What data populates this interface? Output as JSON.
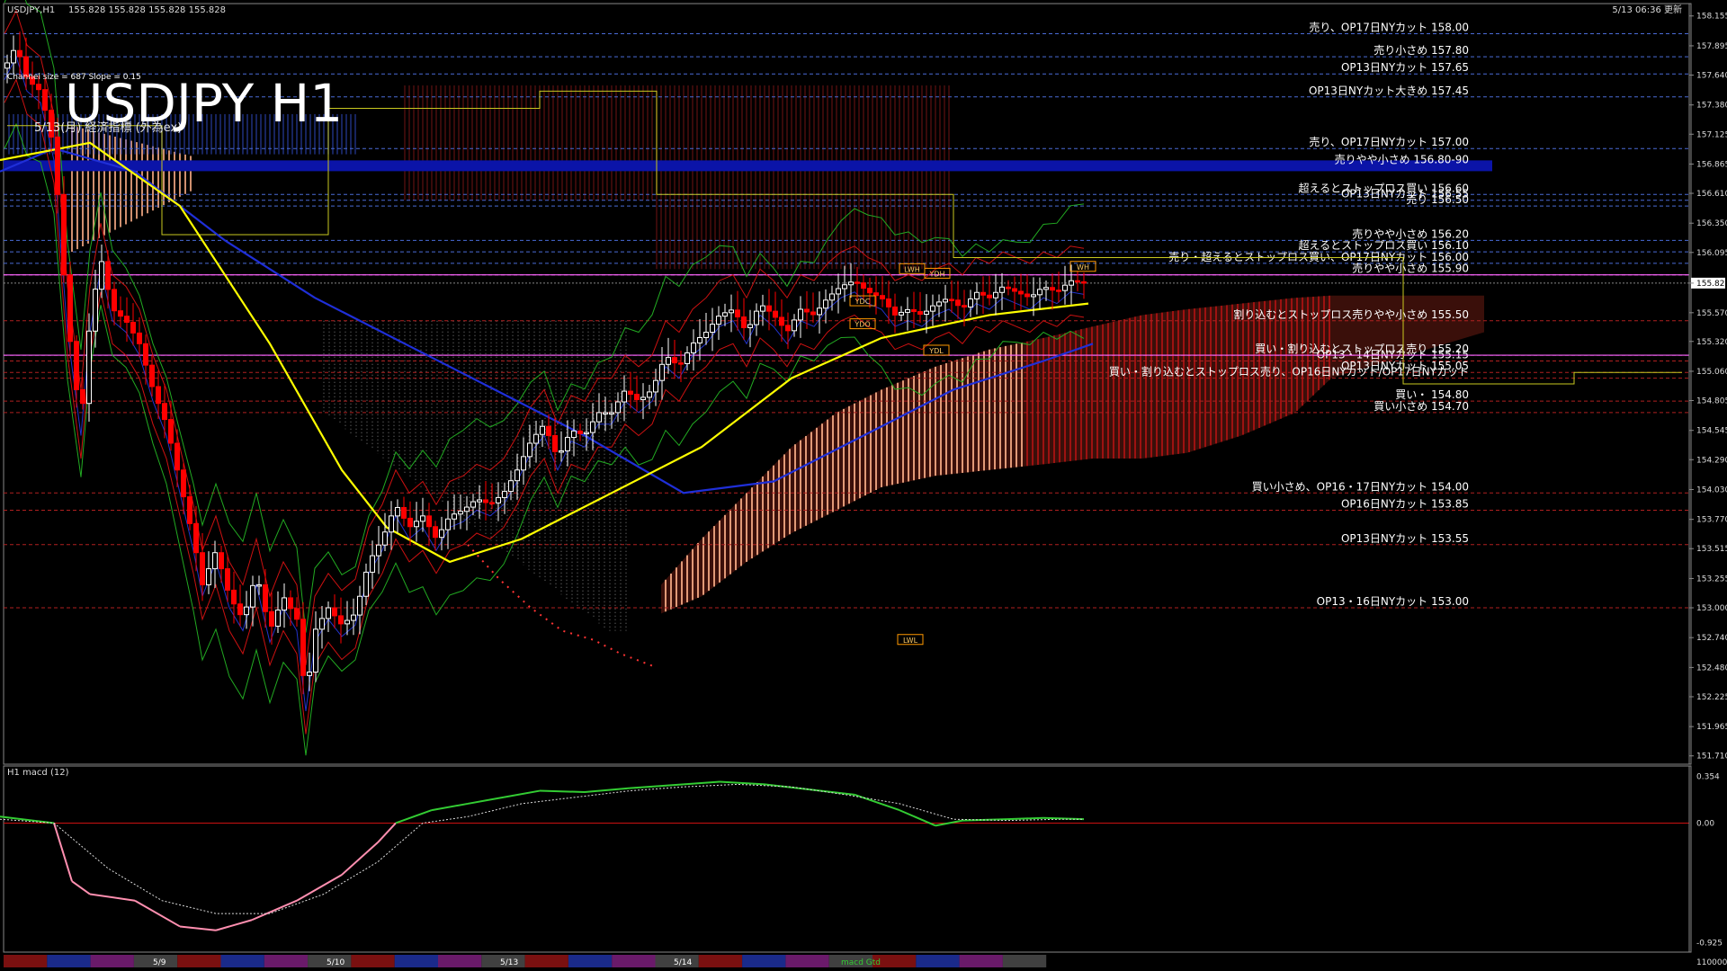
{
  "window": {
    "title": "USDJPY,H1",
    "ohlc": "155.828 155.828 155.828 155.828",
    "timestamp": "5/13 06:36 更新"
  },
  "overlay": {
    "big_title": "USDJPY H1",
    "channel_info": "Channel size = 687 Slope = 0.15",
    "sub_info": "5/13(月) 経済指標 (外為ex)"
  },
  "colors": {
    "background": "#000000",
    "candle_up": "#ffffff",
    "candle_down": "#ff0000",
    "ma_yellow": "#ffff00",
    "ma_blue": "#1f2fd8",
    "cloud_salmon": "#f4a883",
    "cloud_red": "#c81414",
    "macd_green": "#33cc33",
    "macd_pink": "#ff8fb0",
    "band_blue": "#0b14a8"
  },
  "chart_data": {
    "type": "candlestick",
    "symbol": "USDJPY",
    "timeframe": "H1",
    "y_axis_ticks": [
      "158.155",
      "157.895",
      "157.640",
      "157.380",
      "157.125",
      "156.865",
      "156.610",
      "156.350",
      "156.095",
      "155.828",
      "155.570",
      "155.320",
      "155.060",
      "154.805",
      "154.545",
      "154.290",
      "154.030",
      "153.770",
      "153.515",
      "153.255",
      "153.000",
      "152.740",
      "152.480",
      "152.225",
      "151.965",
      "151.710"
    ],
    "ylim": [
      151.7,
      158.2
    ],
    "current_price": "155.828",
    "levels": [
      {
        "price": 158.0,
        "label": "売り、OP17日NYカット 158.00",
        "color": "#4a6bd6"
      },
      {
        "price": 157.8,
        "label": "売り小さめ 157.80",
        "color": "#4a6bd6"
      },
      {
        "price": 157.65,
        "label": "OP13日NYカット 157.65",
        "color": "#4a6bd6"
      },
      {
        "price": 157.45,
        "label": "OP13日NYカット大きめ 157.45",
        "color": "#4a6bd6"
      },
      {
        "price": 157.0,
        "label": "売り、OP17日NYカット 157.00",
        "color": "#4a6bd6"
      },
      {
        "price": 156.85,
        "label": "売りやや小さめ 156.80-90",
        "color": "#0b14a8",
        "band": true
      },
      {
        "price": 156.6,
        "label": "超えるとストップロス買い 156.60",
        "color": "#4a6bd6"
      },
      {
        "price": 156.55,
        "label": "OP13日NYカット 156.55",
        "color": "#4a6bd6"
      },
      {
        "price": 156.5,
        "label": "売り 156.50",
        "color": "#4a6bd6"
      },
      {
        "price": 156.2,
        "label": "売りやや小さめ 156.20",
        "color": "#4a6bd6"
      },
      {
        "price": 156.1,
        "label": "超えるとストップロス買い 156.10",
        "color": "#4a6bd6"
      },
      {
        "price": 156.0,
        "label": "売り・超えるとストップロス買い、OP17日NYカット 156.00",
        "color": "#4a6bd6"
      },
      {
        "price": 155.9,
        "label": "売りやや小さめ 155.90",
        "color": "#ff66ff"
      },
      {
        "price": 155.5,
        "label": "割り込むとストップロス売りやや小さめ 155.50",
        "color": "#b02020"
      },
      {
        "price": 155.2,
        "label": "買い・割り込むとストップロス売り 155.20",
        "color": "#ff66ff"
      },
      {
        "price": 155.15,
        "label": "OP13・14日NYカット 155.15",
        "color": "#b02020"
      },
      {
        "price": 155.05,
        "label": "OP13日NYカット 155.05",
        "color": "#b02020"
      },
      {
        "price": 155.0,
        "label": "買い・割り込むとストップロス売り、OP16日NYカット/OP17日NYカット",
        "color": "#b02020"
      },
      {
        "price": 154.8,
        "label": "買い・ 154.80",
        "color": "#b02020"
      },
      {
        "price": 154.7,
        "label": "買い小さめ 154.70",
        "color": "#b02020"
      },
      {
        "price": 154.0,
        "label": "買い小さめ、OP16・17日NYカット 154.00",
        "color": "#b02020"
      },
      {
        "price": 153.85,
        "label": "OP16日NYカット 153.85",
        "color": "#b02020"
      },
      {
        "price": 153.55,
        "label": "OP13日NYカット 153.55",
        "color": "#b02020"
      },
      {
        "price": 153.0,
        "label": "OP13・16日NYカット 153.00",
        "color": "#b02020"
      }
    ],
    "tags": [
      {
        "text": "LWH",
        "price": 155.95,
        "x": 1000
      },
      {
        "text": "YDH",
        "price": 155.91,
        "x": 1028
      },
      {
        "text": "WH",
        "price": 155.97,
        "x": 1190
      },
      {
        "text": "YDC",
        "price": 155.67,
        "x": 945
      },
      {
        "text": "YDO",
        "price": 155.47,
        "x": 945
      },
      {
        "text": "YDL",
        "price": 155.24,
        "x": 1027
      },
      {
        "text": "LWL",
        "price": 152.72,
        "x": 998
      }
    ],
    "candle_path": [
      [
        5,
        157.7
      ],
      [
        18,
        157.9
      ],
      [
        30,
        157.6
      ],
      [
        45,
        157.5
      ],
      [
        60,
        157.0
      ],
      [
        75,
        155.5
      ],
      [
        90,
        154.6
      ],
      [
        100,
        155.5
      ],
      [
        112,
        156.05
      ],
      [
        125,
        155.6
      ],
      [
        140,
        155.5
      ],
      [
        155,
        155.3
      ],
      [
        170,
        154.9
      ],
      [
        185,
        154.6
      ],
      [
        200,
        154.1
      ],
      [
        215,
        153.6
      ],
      [
        225,
        153.2
      ],
      [
        240,
        153.5
      ],
      [
        255,
        153.1
      ],
      [
        270,
        152.9
      ],
      [
        285,
        153.3
      ],
      [
        300,
        152.8
      ],
      [
        315,
        153.1
      ],
      [
        330,
        152.9
      ],
      [
        340,
        152.2
      ],
      [
        350,
        152.8
      ],
      [
        365,
        153.0
      ],
      [
        380,
        152.85
      ],
      [
        395,
        152.95
      ],
      [
        410,
        153.4
      ],
      [
        425,
        153.6
      ],
      [
        440,
        153.9
      ],
      [
        455,
        153.7
      ],
      [
        470,
        153.8
      ],
      [
        485,
        153.6
      ],
      [
        500,
        153.8
      ],
      [
        515,
        153.85
      ],
      [
        530,
        153.95
      ],
      [
        545,
        153.9
      ],
      [
        560,
        154.0
      ],
      [
        575,
        154.2
      ],
      [
        590,
        154.45
      ],
      [
        605,
        154.6
      ],
      [
        620,
        154.3
      ],
      [
        635,
        154.55
      ],
      [
        650,
        154.5
      ],
      [
        665,
        154.7
      ],
      [
        680,
        154.7
      ],
      [
        695,
        154.9
      ],
      [
        710,
        154.8
      ],
      [
        725,
        154.9
      ],
      [
        740,
        155.2
      ],
      [
        755,
        155.1
      ],
      [
        770,
        155.3
      ],
      [
        785,
        155.4
      ],
      [
        800,
        155.55
      ],
      [
        815,
        155.6
      ],
      [
        830,
        155.4
      ],
      [
        845,
        155.65
      ],
      [
        860,
        155.55
      ],
      [
        875,
        155.4
      ],
      [
        890,
        155.6
      ],
      [
        905,
        155.55
      ],
      [
        920,
        155.7
      ],
      [
        935,
        155.8
      ],
      [
        950,
        155.85
      ],
      [
        965,
        155.75
      ],
      [
        980,
        155.7
      ],
      [
        995,
        155.55
      ],
      [
        1010,
        155.6
      ],
      [
        1025,
        155.55
      ],
      [
        1040,
        155.65
      ],
      [
        1055,
        155.7
      ],
      [
        1070,
        155.6
      ],
      [
        1085,
        155.75
      ],
      [
        1100,
        155.7
      ],
      [
        1115,
        155.8
      ],
      [
        1130,
        155.75
      ],
      [
        1145,
        155.7
      ],
      [
        1160,
        155.8
      ],
      [
        1175,
        155.75
      ],
      [
        1190,
        155.85
      ],
      [
        1205,
        155.83
      ]
    ],
    "ma_yellow": [
      [
        0,
        156.9
      ],
      [
        100,
        157.05
      ],
      [
        200,
        156.5
      ],
      [
        300,
        155.3
      ],
      [
        380,
        154.2
      ],
      [
        430,
        153.7
      ],
      [
        500,
        153.4
      ],
      [
        580,
        153.6
      ],
      [
        680,
        154.0
      ],
      [
        780,
        154.4
      ],
      [
        880,
        155.0
      ],
      [
        980,
        155.35
      ],
      [
        1100,
        155.55
      ],
      [
        1210,
        155.65
      ]
    ],
    "ma_blue": [
      [
        0,
        156.8
      ],
      [
        60,
        157.0
      ],
      [
        150,
        156.8
      ],
      [
        250,
        156.2
      ],
      [
        350,
        155.7
      ],
      [
        450,
        155.3
      ],
      [
        550,
        154.9
      ],
      [
        650,
        154.5
      ],
      [
        760,
        154.0
      ],
      [
        860,
        154.1
      ],
      [
        960,
        154.5
      ],
      [
        1060,
        154.9
      ],
      [
        1160,
        155.15
      ],
      [
        1215,
        155.3
      ]
    ],
    "macd": {
      "label": "H1 macd (12)",
      "ticks": [
        "0.354",
        "0.00",
        "-0.925"
      ],
      "ylim": [
        -0.95,
        0.4
      ],
      "main": [
        [
          0,
          0.05
        ],
        [
          60,
          0.0
        ],
        [
          80,
          -0.45
        ],
        [
          100,
          -0.55
        ],
        [
          150,
          -0.6
        ],
        [
          200,
          -0.8
        ],
        [
          240,
          -0.83
        ],
        [
          280,
          -0.75
        ],
        [
          330,
          -0.6
        ],
        [
          380,
          -0.4
        ],
        [
          420,
          -0.15
        ],
        [
          440,
          0.0
        ],
        [
          480,
          0.1
        ],
        [
          520,
          0.15
        ],
        [
          560,
          0.2
        ],
        [
          600,
          0.25
        ],
        [
          650,
          0.24
        ],
        [
          700,
          0.27
        ],
        [
          760,
          0.3
        ],
        [
          800,
          0.32
        ],
        [
          850,
          0.3
        ],
        [
          900,
          0.26
        ],
        [
          950,
          0.22
        ],
        [
          1000,
          0.1
        ],
        [
          1040,
          -0.02
        ],
        [
          1070,
          0.02
        ],
        [
          1120,
          0.03
        ],
        [
          1160,
          0.04
        ],
        [
          1205,
          0.03
        ]
      ],
      "signal": [
        [
          0,
          0.03
        ],
        [
          60,
          0.0
        ],
        [
          120,
          -0.35
        ],
        [
          180,
          -0.6
        ],
        [
          240,
          -0.7
        ],
        [
          300,
          -0.7
        ],
        [
          360,
          -0.55
        ],
        [
          420,
          -0.3
        ],
        [
          470,
          0.0
        ],
        [
          520,
          0.05
        ],
        [
          580,
          0.15
        ],
        [
          640,
          0.2
        ],
        [
          700,
          0.25
        ],
        [
          760,
          0.28
        ],
        [
          820,
          0.3
        ],
        [
          880,
          0.28
        ],
        [
          940,
          0.22
        ],
        [
          1000,
          0.15
        ],
        [
          1060,
          0.03
        ],
        [
          1120,
          0.02
        ],
        [
          1180,
          0.03
        ],
        [
          1205,
          0.03
        ]
      ]
    }
  },
  "date_bar": {
    "labels": [
      {
        "text": "5/9",
        "x": 170
      },
      {
        "text": "5/10",
        "x": 363
      },
      {
        "text": "5/13",
        "x": 556
      },
      {
        "text": "5/14",
        "x": 749
      },
      {
        "text": "macd Gtd",
        "x": 935
      }
    ],
    "right_value": "110000"
  }
}
